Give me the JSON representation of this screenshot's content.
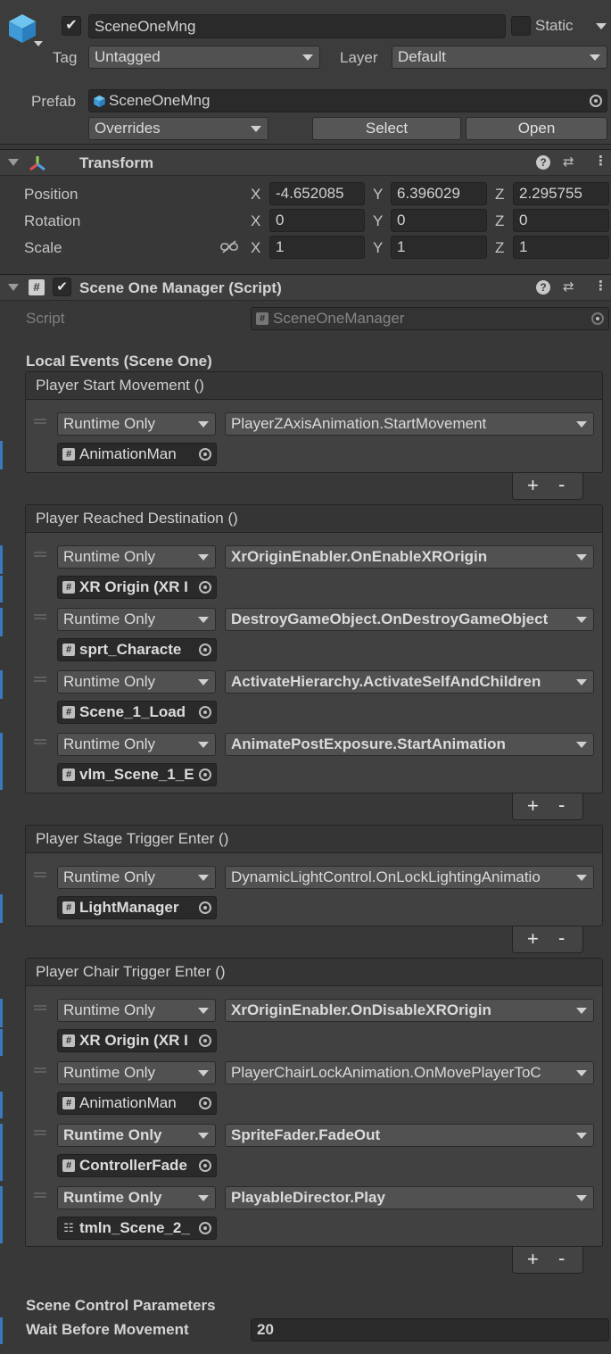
{
  "header": {
    "object_name": "SceneOneMng",
    "static_label": "Static",
    "tag_label": "Tag",
    "tag_value": "Untagged",
    "layer_label": "Layer",
    "layer_value": "Default",
    "prefab_label": "Prefab",
    "prefab_value": "SceneOneMng",
    "overrides_label": "Overrides",
    "select_label": "Select",
    "open_label": "Open"
  },
  "transform": {
    "title": "Transform",
    "position": {
      "label": "Position",
      "x": "-4.652085",
      "y": "6.396029",
      "z": "2.295755"
    },
    "rotation": {
      "label": "Rotation",
      "x": "0",
      "y": "0",
      "z": "0"
    },
    "scale": {
      "label": "Scale",
      "x": "1",
      "y": "1",
      "z": "1"
    },
    "axis_x": "X",
    "axis_y": "Y",
    "axis_z": "Z"
  },
  "script_component": {
    "title": "Scene One Manager (Script)",
    "script_label": "Script",
    "script_value": "SceneOneManager",
    "local_events_label": "Local Events (Scene One)",
    "runtime_label": "Runtime Only",
    "events": [
      {
        "title": "Player Start Movement ()",
        "entries": [
          {
            "function": "PlayerZAxisAnimation.StartMovement",
            "object": "AnimationMan"
          }
        ]
      },
      {
        "title": "Player Reached Destination ()",
        "entries": [
          {
            "function": "XrOriginEnabler.OnEnableXROrigin",
            "object": "XR Origin (XR I"
          },
          {
            "function": "DestroyGameObject.OnDestroyGameObject",
            "object": "sprt_Characte"
          },
          {
            "function": "ActivateHierarchy.ActivateSelfAndChildren",
            "object": "Scene_1_Load"
          },
          {
            "function": "AnimatePostExposure.StartAnimation",
            "object": "vlm_Scene_1_E"
          }
        ]
      },
      {
        "title": "Player Stage Trigger Enter ()",
        "entries": [
          {
            "function": "DynamicLightControl.OnLockLightingAnimatio",
            "object": "LightManager"
          }
        ]
      },
      {
        "title": "Player Chair Trigger Enter ()",
        "entries": [
          {
            "function": "XrOriginEnabler.OnDisableXROrigin",
            "object": "XR Origin (XR I"
          },
          {
            "function": "PlayerChairLockAnimation.OnMovePlayerToC",
            "object": "AnimationMan"
          },
          {
            "function": "SpriteFader.FadeOut",
            "object": "ControllerFade"
          },
          {
            "function": "PlayableDirector.Play",
            "object": "tmln_Scene_2_"
          }
        ]
      }
    ],
    "plus": "+",
    "minus": "-",
    "scene_control_label": "Scene Control Parameters",
    "wait_label": "Wait Before Movement",
    "wait_value": "20"
  }
}
